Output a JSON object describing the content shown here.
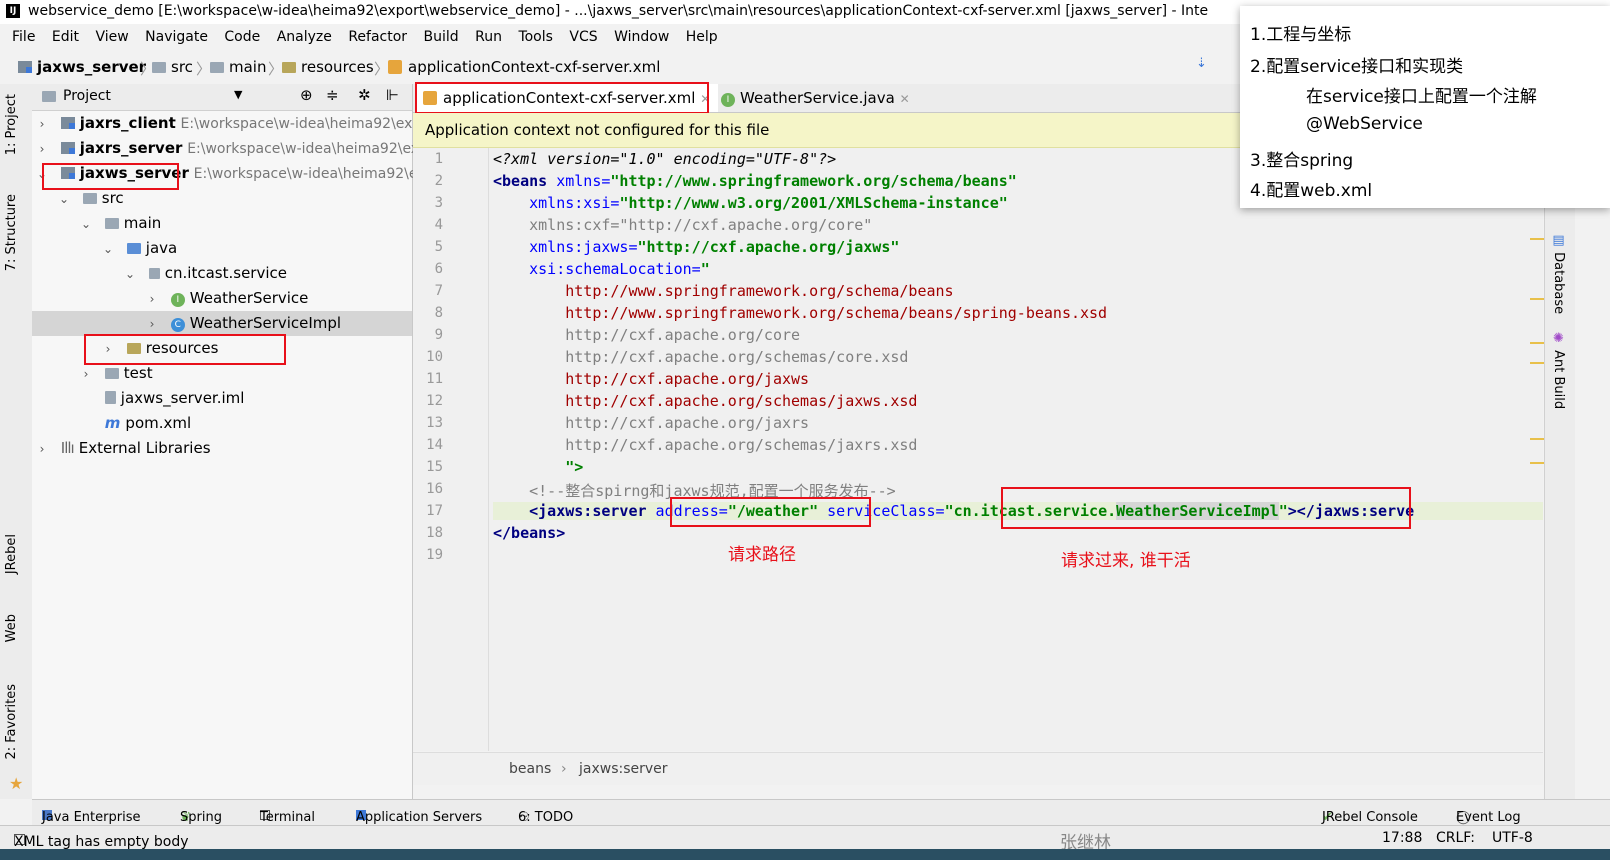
{
  "window": {
    "title": "webservice_demo [E:\\workspace\\w-idea\\heima92\\export\\webservice_demo] - ...\\jaxws_server\\src\\main\\resources\\applicationContext-cxf-server.xml [jaxws_server] - Inte"
  },
  "menu": [
    "File",
    "Edit",
    "View",
    "Navigate",
    "Code",
    "Analyze",
    "Refactor",
    "Build",
    "Run",
    "Tools",
    "VCS",
    "Window",
    "Help"
  ],
  "navbar": {
    "crumbs": [
      "jaxws_server",
      "src",
      "main",
      "resources",
      "applicationContext-cxf-server.xml"
    ]
  },
  "left_tabs": [
    "1: Project",
    "7: Structure",
    "JRebel",
    "Web",
    "2: Favorites"
  ],
  "project": {
    "header": "Project",
    "tree": [
      {
        "label": "jaxrs_client",
        "path": "E:\\workspace\\w-idea\\heima92\\exp"
      },
      {
        "label": "jaxrs_server",
        "path": "E:\\workspace\\w-idea\\heima92\\exp"
      },
      {
        "label": "jaxws_server",
        "path": "E:\\workspace\\w-idea\\heima92\\ex"
      },
      {
        "label": "src"
      },
      {
        "label": "main"
      },
      {
        "label": "java"
      },
      {
        "label": "cn.itcast.service"
      },
      {
        "label": "WeatherService"
      },
      {
        "label": "WeatherServiceImpl"
      },
      {
        "label": "resources"
      },
      {
        "label": "test"
      },
      {
        "label": "jaxws_server.iml"
      },
      {
        "label": "pom.xml"
      },
      {
        "label": "External Libraries"
      }
    ]
  },
  "tabs": [
    "applicationContext-cxf-server.xml",
    "WeatherService.java"
  ],
  "banner": "Application context not configured for this file",
  "code": {
    "line_numbers": [
      "1",
      "2",
      "3",
      "4",
      "5",
      "6",
      "7",
      "8",
      "9",
      "10",
      "11",
      "12",
      "13",
      "14",
      "15",
      "16",
      "17",
      "18",
      "19"
    ],
    "l1": "<?xml version=\"1.0\" encoding=\"UTF-8\"?>",
    "l2_tag": "<beans",
    "l2_attr": " xmlns=",
    "l2_val": "\"http://www.springframework.org/schema/beans\"",
    "l3_attr": "    xmlns:xsi=",
    "l3_val": "\"http://www.w3.org/2001/XMLSchema-instance\"",
    "l4": "    xmlns:cxf=\"http://cxf.apache.org/core\"",
    "l5_attr": "    xmlns:jaxws=",
    "l5_val": "\"http://cxf.apache.org/jaxws\"",
    "l6_attr": "    xsi:schemaLocation=",
    "l6_val": "\"",
    "l7": "        http://www.springframework.org/schema/beans",
    "l8": "        http://www.springframework.org/schema/beans/spring-beans.xsd",
    "l9": "        http://cxf.apache.org/core",
    "l10": "        http://cxf.apache.org/schemas/core.xsd",
    "l11": "        http://cxf.apache.org/jaxws",
    "l12": "        http://cxf.apache.org/schemas/jaxws.xsd",
    "l13": "        http://cxf.apache.org/jaxrs",
    "l14": "        http://cxf.apache.org/schemas/jaxrs.xsd",
    "l15": "        \">",
    "l16": "    <!--整合spirng和jaxws规范,配置一个服务发布-->",
    "l17_tag": "    <jaxws:server",
    "l17_a1": " address=",
    "l17_v1": "\"/weather\"",
    "l17_a2": " serviceClass=",
    "l17_v2a": "\"cn.itcast.service.",
    "l17_v2b": "WeatherServiceImpl",
    "l17_v2c": "\"",
    "l17_end": "></jaxws:serve",
    "l18": "</beans>"
  },
  "annotations": {
    "path": "请求路径",
    "worker": "请求过来, 谁干活"
  },
  "editor_crumbs": [
    "beans",
    "jaxws:server"
  ],
  "right_tabs": [
    "Database",
    "Ant Build"
  ],
  "bottom_tabs": [
    "Java Enterprise",
    "Spring",
    "Terminal",
    "Application Servers",
    "6: TODO",
    "JRebel Console",
    "Event Log"
  ],
  "status": {
    "message": "XML tag has empty body",
    "position": "17:88",
    "line_sep": "CRLF:",
    "encoding": "UTF-8",
    "watermark": "张继林"
  },
  "notes": [
    "1.工程与坐标",
    "2.配置service接口和实现类",
    "在service接口上配置一个注解",
    "@WebService",
    "3.整合spring",
    "4.配置web.xml"
  ],
  "colors": {
    "annotation_red": "#e8101a",
    "banner_bg": "#f5f5c8"
  }
}
